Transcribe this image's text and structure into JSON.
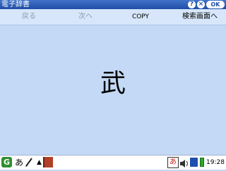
{
  "window": {
    "title": "電子辞書",
    "help_label": "?",
    "close_label": "×",
    "ok_label": "OK"
  },
  "toolbar": {
    "back_label": "戻る",
    "next_label": "次へ",
    "copy_label": "COPY",
    "search_screen_label": "検索画面へ"
  },
  "content": {
    "entry": "武"
  },
  "taskbar": {
    "start_label": "G",
    "ime_label": "あ",
    "ime_right_label": "あ",
    "clock": "19:28"
  },
  "icons": {
    "start": "start-menu-icon",
    "pen": "pen-icon",
    "caret": "caret-up-icon",
    "book": "book-icon",
    "speaker": "speaker-icon",
    "card": "memory-card-icon",
    "battery": "battery-icon"
  },
  "colors": {
    "titlebar": "#1f4ea6",
    "background": "#c3d9f5",
    "disabled_text": "#8f9aac"
  }
}
